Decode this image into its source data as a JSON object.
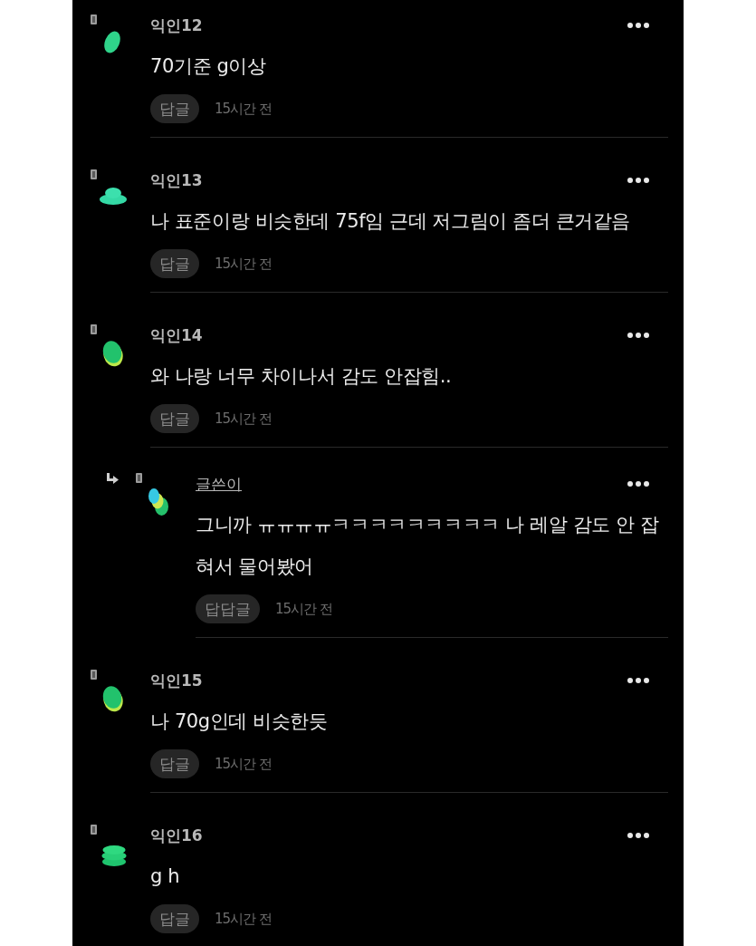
{
  "comments": [
    {
      "author": "익인12",
      "op": false,
      "avatar": {
        "kind": "oval"
      },
      "body": "70기준 g이상",
      "reply_label": "답글",
      "time": "15시간 전"
    },
    {
      "author": "익인13",
      "op": false,
      "avatar": {
        "kind": "dome"
      },
      "body": "나 표준이랑 비슷한데 75f임 근데 저그림이 좀더 큰거같음",
      "reply_label": "답글",
      "time": "15시간 전"
    },
    {
      "author": "익인14",
      "op": false,
      "avatar": {
        "kind": "shell"
      },
      "body": "와 나랑 너무 차이나서 감도 안잡힘..",
      "reply_label": "답글",
      "time": "15시간 전",
      "children": [
        {
          "author": "글쓴이",
          "op": true,
          "avatar": {
            "kind": "cluster"
          },
          "body": "그니까 ㅠㅠㅠㅠㅋㅋㅋㅋㅋㅋㅋㅋㅋ 나 레알 감도 안 잡혀서 물어봤어",
          "reply_label": "답답글",
          "time": "15시간 전"
        }
      ]
    },
    {
      "author": "익인15",
      "op": false,
      "avatar": {
        "kind": "shell"
      },
      "body": "나 70g인데 비슷한듯",
      "reply_label": "답글",
      "time": "15시간 전"
    },
    {
      "author": "익인16",
      "op": false,
      "avatar": {
        "kind": "stack"
      },
      "body": "g h",
      "reply_label": "답글",
      "time": "15시간 전"
    }
  ]
}
